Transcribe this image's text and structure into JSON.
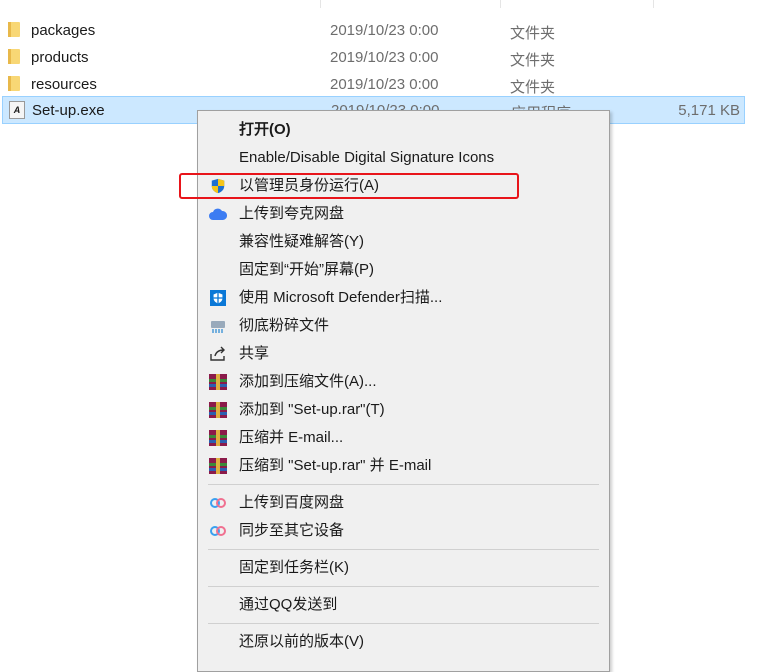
{
  "files": [
    {
      "name": "packages",
      "date": "2019/10/23 0:00",
      "type": "文件夹",
      "size": ""
    },
    {
      "name": "products",
      "date": "2019/10/23 0:00",
      "type": "文件夹",
      "size": ""
    },
    {
      "name": "resources",
      "date": "2019/10/23 0:00",
      "type": "文件夹",
      "size": ""
    },
    {
      "name": "Set-up.exe",
      "date": "2019/10/23 0:00",
      "type": "应用程序",
      "size": "5,171 KB"
    }
  ],
  "menu": {
    "open": "打开(O)",
    "sig": "Enable/Disable Digital Signature Icons",
    "admin": "以管理员身份运行(A)",
    "quark": "上传到夸克网盘",
    "compat": "兼容性疑难解答(Y)",
    "pinstart": "固定到“开始”屏幕(P)",
    "defender": "使用 Microsoft Defender扫描...",
    "shred": "彻底粉碎文件",
    "share": "共享",
    "addarc": "添加到压缩文件(A)...",
    "addrar": "添加到 \"Set-up.rar\"(T)",
    "email": "压缩并 E-mail...",
    "rarmail": "压缩到 \"Set-up.rar\" 并 E-mail",
    "baidu": "上传到百度网盘",
    "sync": "同步至其它设备",
    "taskbar": "固定到任务栏(K)",
    "qq": "通过QQ发送到",
    "restore": "还原以前的版本(V)"
  }
}
